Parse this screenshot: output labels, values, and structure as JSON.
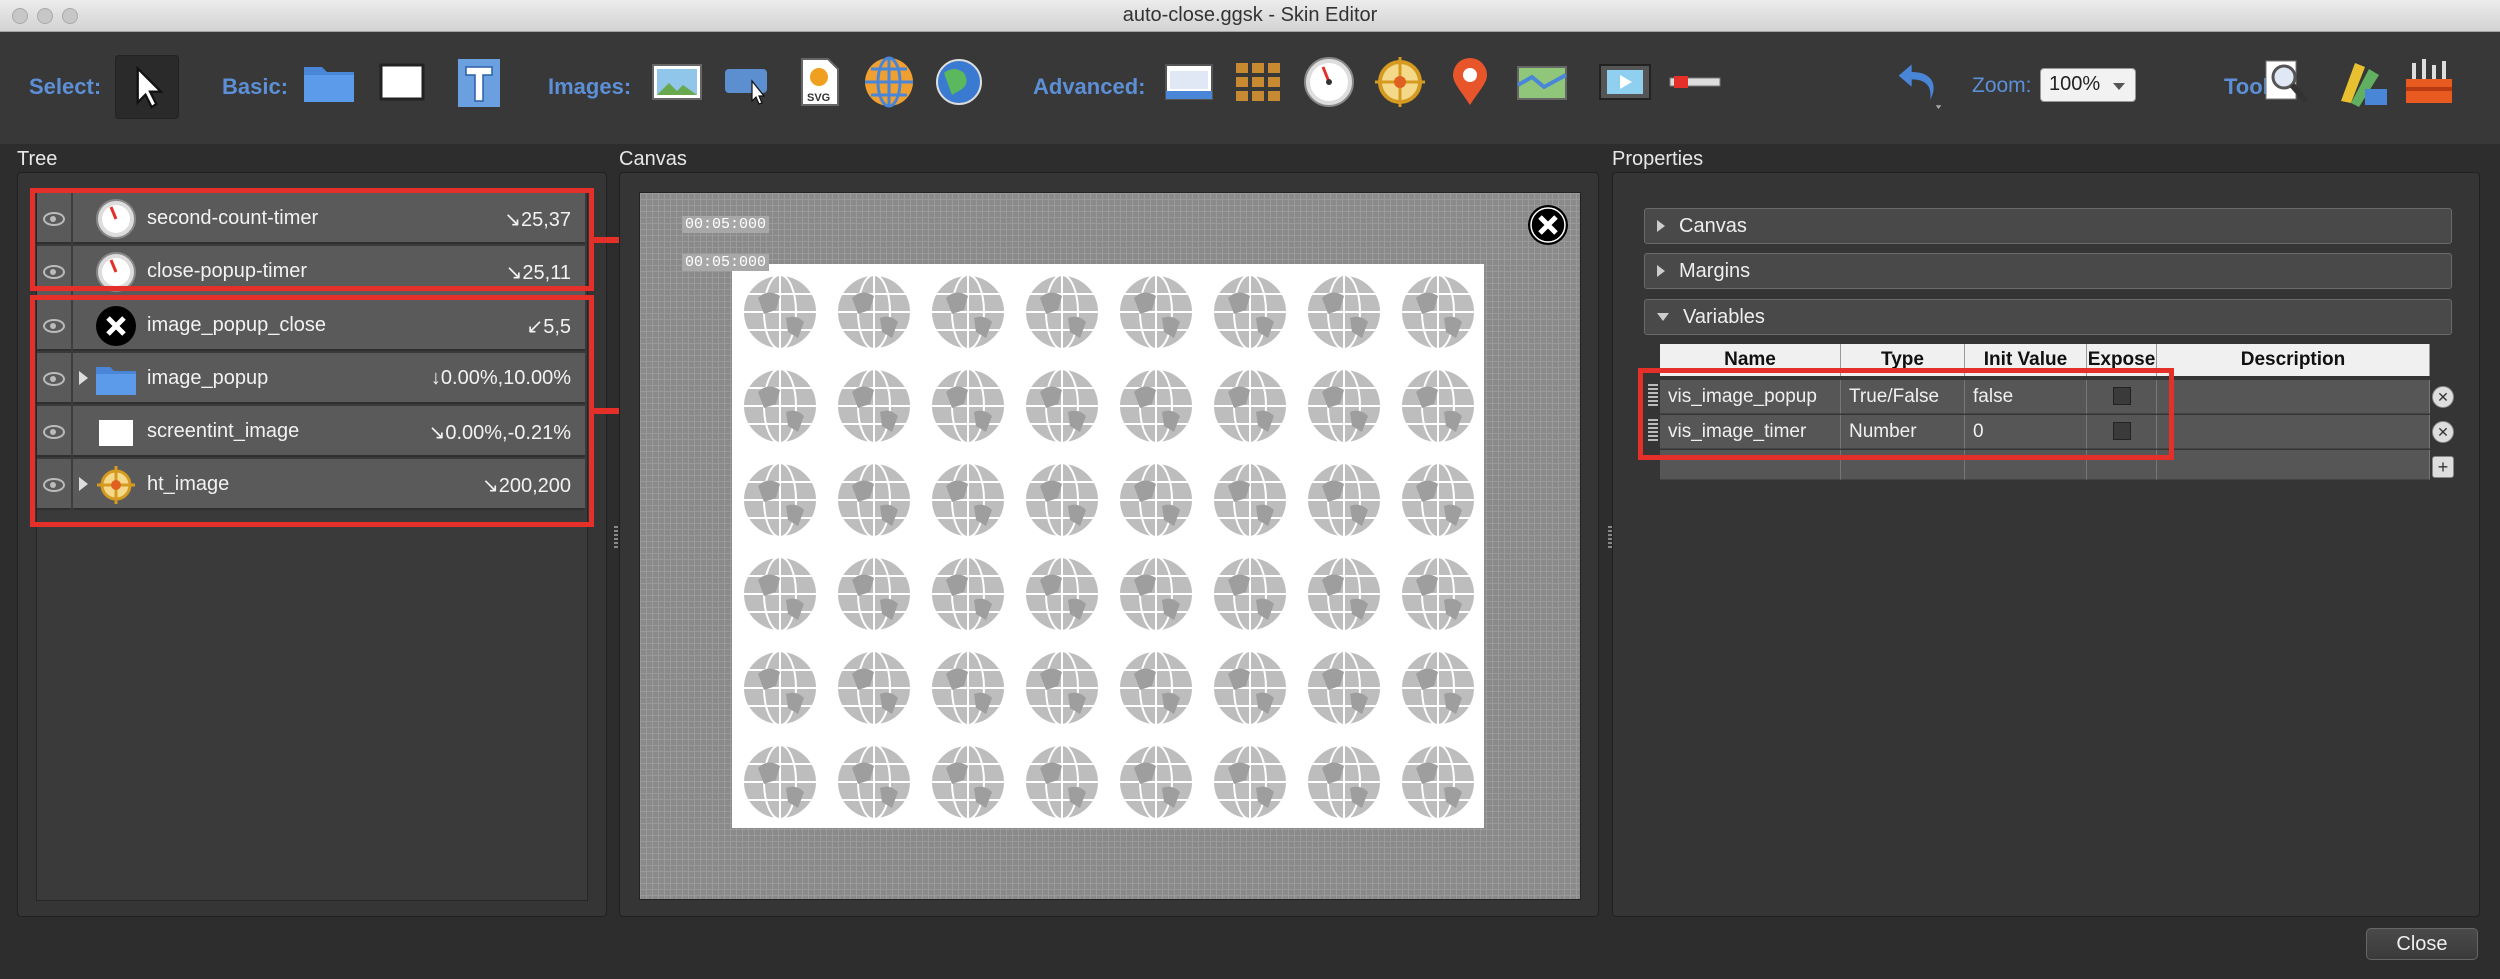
{
  "window": {
    "title": "auto-close.ggsk - Skin Editor"
  },
  "toolbar": {
    "select_label": "Select:",
    "basic_label": "Basic:",
    "images_label": "Images:",
    "advanced_label": "Advanced:",
    "zoom_label": "Zoom:",
    "zoom_value": "100%",
    "tools_label": "Tools:",
    "tools": [
      "pointer-tool",
      "container-tool",
      "rectangle-tool",
      "text-tool",
      "image-tool",
      "hotspot-image-tool",
      "svg-tool",
      "globe-tool",
      "hotspot-globe-tool",
      "cloner-tool",
      "grid-tool",
      "timer-tool",
      "compass-tool",
      "pin-tool",
      "map-tool",
      "video-tool",
      "scrollbar-tool",
      "undo",
      "search-tool",
      "color-tool",
      "toolbox-tool"
    ]
  },
  "panels": {
    "tree": "Tree",
    "canvas": "Canvas",
    "properties": "Properties"
  },
  "tree": {
    "items": [
      {
        "name": "second-count-timer",
        "pos": "↘25,37",
        "type": "timer",
        "expandable": false
      },
      {
        "name": "close-popup-timer",
        "pos": "↘25,11",
        "type": "timer",
        "expandable": false
      },
      {
        "name": "image_popup_close",
        "pos": "↙5,5",
        "type": "close",
        "expandable": false
      },
      {
        "name": "image_popup",
        "pos": "↓0.00%,10.00%",
        "type": "folder",
        "expandable": true
      },
      {
        "name": "screentint_image",
        "pos": "↘0.00%,-0.21%",
        "type": "rectangle",
        "expandable": false
      },
      {
        "name": "ht_image",
        "pos": "↘200,200",
        "type": "hotspot",
        "expandable": true
      }
    ]
  },
  "canvas": {
    "timer1": "00:05:000",
    "timer2": "00:05:000"
  },
  "properties": {
    "sections": [
      {
        "label": "Canvas",
        "expanded": false
      },
      {
        "label": "Margins",
        "expanded": false
      },
      {
        "label": "Variables",
        "expanded": true
      }
    ],
    "variables": {
      "headers": {
        "name": "Name",
        "type": "Type",
        "init": "Init Value",
        "expose": "Expose",
        "description": "Description"
      },
      "rows": [
        {
          "name": "vis_image_popup",
          "type": "True/False",
          "init": "false",
          "expose": false,
          "description": ""
        },
        {
          "name": "vis_image_timer",
          "type": "Number",
          "init": "0",
          "expose": false,
          "description": ""
        }
      ]
    }
  },
  "footer": {
    "close_label": "Close"
  },
  "colors": {
    "highlight": "#e43028",
    "accent_blue": "#5c8fd6"
  }
}
